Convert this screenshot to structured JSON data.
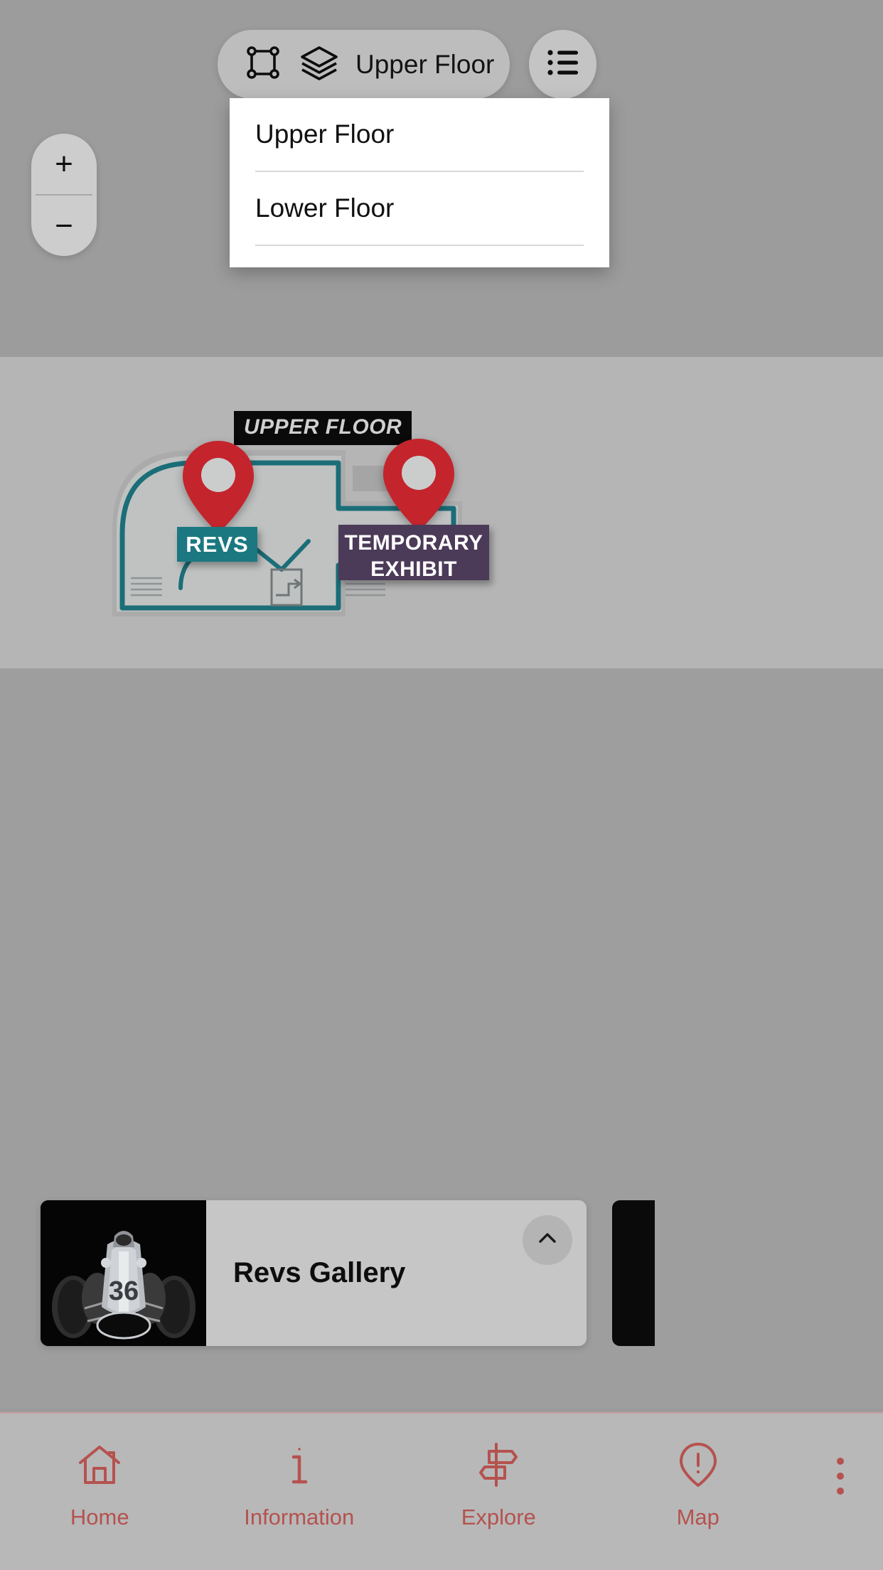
{
  "map": {
    "floor_badge": "UPPER FLOOR",
    "rooms": [
      {
        "id": "revs",
        "label": "REVS",
        "color": "#1b7881"
      },
      {
        "id": "temporary-exhibit",
        "label": "TEMPORARY\nEXHIBIT",
        "line1": "TEMPORARY",
        "line2": "EXHIBIT",
        "color": "#4b3a58"
      }
    ],
    "pin_color": "#c4242c",
    "plan_stroke": "#1b6e78"
  },
  "floor_selector": {
    "current_floor": "Upper Floor",
    "frame_icon": "frame-icon",
    "layers_icon": "layers-icon"
  },
  "list_button": {
    "icon": "list-icon"
  },
  "dropdown": {
    "options": [
      {
        "label": "Upper Floor",
        "selected": true
      },
      {
        "label": "Lower Floor",
        "selected": false
      }
    ]
  },
  "zoom_controls": {
    "zoom_in": "+",
    "zoom_out": "−"
  },
  "poi_card": {
    "title": "Revs Gallery",
    "thumb_alt": "vintage-race-car-36",
    "car_number": "36",
    "collapse_icon": "chevron-up-icon"
  },
  "bottom_nav": {
    "accent_color": "#b5524f",
    "items": [
      {
        "label": "Home",
        "icon": "home-icon"
      },
      {
        "label": "Information",
        "icon": "info-icon"
      },
      {
        "label": "Explore",
        "icon": "signpost-icon"
      },
      {
        "label": "Map",
        "icon": "map-pin-alert-icon"
      }
    ],
    "overflow_icon": "more-vertical-icon"
  }
}
